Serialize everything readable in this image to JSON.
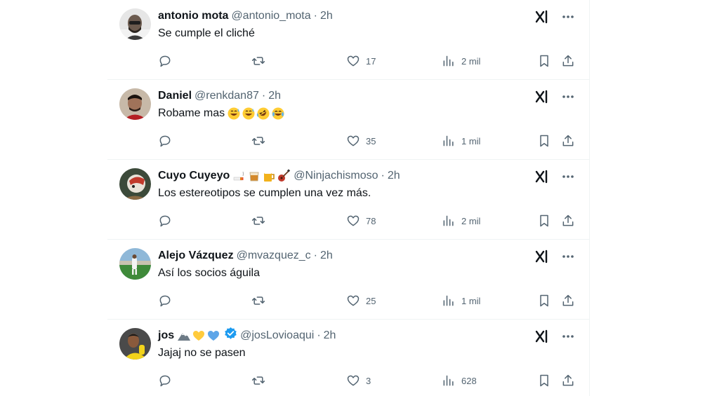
{
  "colors": {
    "text": "#0f1419",
    "secondary": "#536471",
    "border": "#eff3f4",
    "verified": "#1d9bf0"
  },
  "posts": [
    {
      "name": "antonio mota",
      "handle": "@antonio_mota",
      "separator": "·",
      "time": "2h",
      "text": "Se cumple el cliché",
      "replies": "",
      "reposts": "",
      "likes": "17",
      "views": "2 mil",
      "avatar_desc": "man with sunglasses and beard"
    },
    {
      "name": "Daniel",
      "handle": "@renkdan87",
      "separator": "·",
      "time": "2h",
      "text": "Robame mas",
      "text_emojis": [
        "grinning-sweat",
        "grinning-sweat",
        "rolling-laughing",
        "tears-of-joy"
      ],
      "replies": "",
      "reposts": "",
      "likes": "35",
      "views": "1 mil",
      "avatar_desc": "man in red jersey"
    },
    {
      "name": "Cuyo Cuyeyo",
      "name_emojis": [
        "cigarette",
        "whisky-glass",
        "beer-mug",
        "guitar"
      ],
      "handle": "@Ninjachismoso",
      "separator": "·",
      "time": "2h",
      "text": "Los estereotipos se cumplen una vez más.",
      "replies": "",
      "reposts": "",
      "likes": "78",
      "views": "2 mil",
      "avatar_desc": "cartoon character"
    },
    {
      "name": "Alejo Vázquez",
      "handle": "@mvazquez_c",
      "separator": "·",
      "time": "2h",
      "text": "Así los socios águila",
      "replies": "",
      "reposts": "",
      "likes": "25",
      "views": "1 mil",
      "avatar_desc": "player on green field"
    },
    {
      "name": "jos",
      "name_emojis": [
        "mountain",
        "yellow-heart",
        "blue-heart"
      ],
      "verified": true,
      "handle": "@josLovioaqui",
      "separator": "·",
      "time": "2h",
      "text": "Jajaj no se pasen",
      "replies": "",
      "reposts": "",
      "likes": "3",
      "views": "628",
      "avatar_desc": "person in yellow jersey"
    }
  ]
}
